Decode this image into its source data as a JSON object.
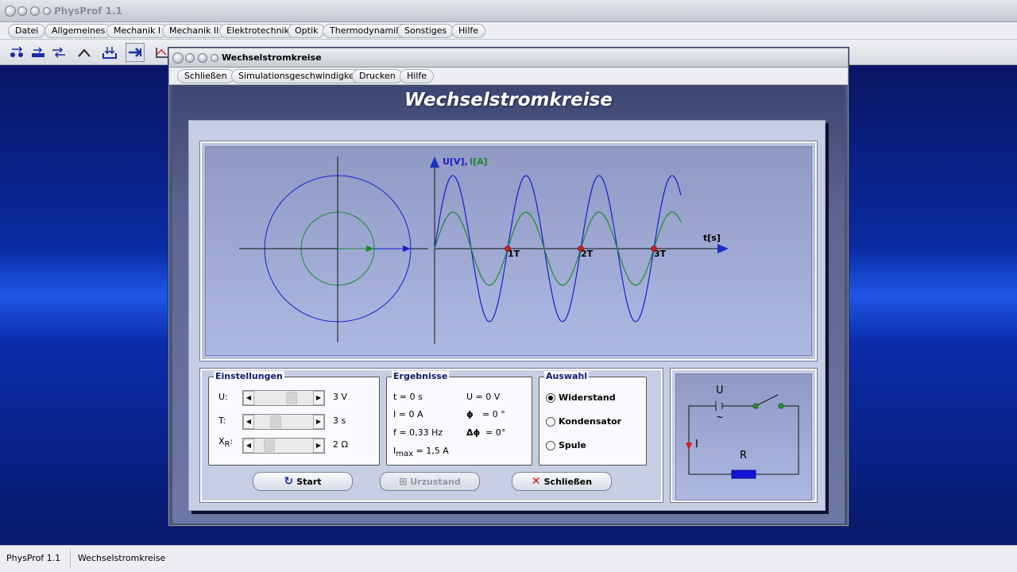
{
  "app": {
    "title": "PhysProf 1.1",
    "menu": [
      "Datei",
      "Allgemeines",
      "Mechanik I",
      "Mechanik II",
      "Elektrotechnik",
      "Optik",
      "Thermodynamik",
      "Sonstiges",
      "Hilfe"
    ]
  },
  "toolbar": {
    "icons": [
      "connect-icon",
      "move-icon",
      "swap-icon",
      "wave-icon",
      "import-icon",
      "arrow-right-icon",
      "graph-icon"
    ]
  },
  "child": {
    "title": "Wechselstromkreise",
    "menu": [
      "Schließen",
      "Simulationsgeschwindigkeit",
      "Drucken",
      "Hilfe"
    ],
    "heading": "Wechselstromkreise"
  },
  "graph": {
    "y_label_u": "U[V],",
    "y_label_i": "I[A]",
    "x_label": "t[s]",
    "period_labels": [
      "1T",
      "2T",
      "3T"
    ],
    "colors": {
      "voltage": "#1c1ccc",
      "current": "#1e8a2e",
      "axis_arrow": "#1c2cc8",
      "marker": "#cc2222"
    }
  },
  "settings": {
    "title": "Einstellungen",
    "rows": [
      {
        "label": "U:",
        "value": "3 V",
        "level": 0.66
      },
      {
        "label": "T:",
        "value": "3 s",
        "level": 0.33
      },
      {
        "label": "X",
        "sub": "R",
        "suffix": ":",
        "value": "2 Ω",
        "level": 0.2
      }
    ]
  },
  "results": {
    "title": "Ergebnisse",
    "t": "t = 0 s",
    "i": "I = 0 A",
    "f": "f = 0,33 Hz",
    "imax_prefix": "I",
    "imax_sub": "max",
    "imax_value": "= 1,5 A",
    "u": "U = 0 V",
    "phi": "= 0 °",
    "dphi": "= 0°"
  },
  "selection": {
    "title": "Auswahl",
    "options": [
      {
        "label": "Widerstand",
        "selected": true
      },
      {
        "label": "Kondensator",
        "selected": false
      },
      {
        "label": "Spule",
        "selected": false
      }
    ]
  },
  "buttons": {
    "start": "Start",
    "reset": "Urzustand",
    "close": "Schließen"
  },
  "circuit": {
    "u_label": "U",
    "ac_symbol": "~",
    "i_label": "I",
    "r_label": "R"
  },
  "status": {
    "app": "PhysProf 1.1",
    "module": "Wechselstromkreise"
  }
}
